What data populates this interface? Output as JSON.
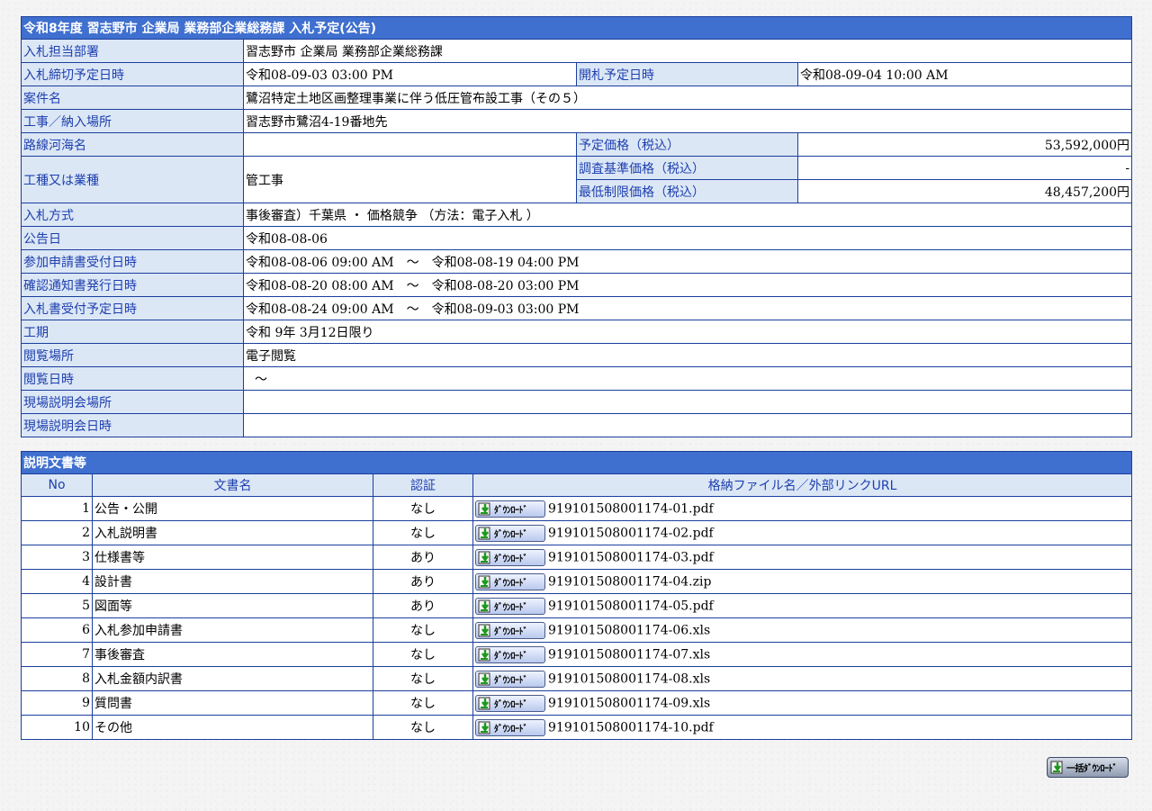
{
  "info": {
    "title": "令和8年度 習志野市 企業局 業務部企業総務課 入札予定(公告)",
    "rows": {
      "dept": {
        "label": "入札担当部署",
        "value": "習志野市 企業局 業務部企業総務課"
      },
      "deadline": {
        "label": "入札締切予定日時",
        "value": "令和08-09-03 03:00 PM"
      },
      "opening": {
        "label": "開札予定日時",
        "value": "令和08-09-04 10:00 AM"
      },
      "project": {
        "label": "案件名",
        "value": "鷺沼特定土地区画整理事業に伴う低圧管布設工事（その５）"
      },
      "location": {
        "label": "工事／納入場所",
        "value": "習志野市鷺沼4-19番地先"
      },
      "route": {
        "label": "路線河海名",
        "value": ""
      },
      "planned_price": {
        "label": "予定価格（税込）",
        "value": "53,592,000円"
      },
      "category": {
        "label": "工種又は業種",
        "value": "管工事"
      },
      "survey_price": {
        "label": "調査基準価格（税込）",
        "value": "-"
      },
      "min_price": {
        "label": "最低制限価格（税込）",
        "value": "48,457,200円"
      },
      "method": {
        "label": "入札方式",
        "value": "事後審査）千葉県 ・ 価格競争 （方法：電子入札 ）"
      },
      "notice_date": {
        "label": "公告日",
        "value": "令和08-08-06"
      },
      "application": {
        "label": "参加申請書受付日時",
        "value": "令和08-08-06 09:00 AM　～　令和08-08-19 04:00 PM"
      },
      "confirmation": {
        "label": "確認通知書発行日時",
        "value": "令和08-08-20 08:00 AM　～　令和08-08-20 03:00 PM"
      },
      "bid_receipt": {
        "label": "入札書受付予定日時",
        "value": "令和08-08-24 09:00 AM　～　令和08-09-03 03:00 PM"
      },
      "period": {
        "label": "工期",
        "value": "令和 9年 3月12日限り"
      },
      "viewing_place": {
        "label": "閲覧場所",
        "value": "電子閲覧"
      },
      "viewing_date": {
        "label": "閲覧日時",
        "value": "～"
      },
      "briefing_place": {
        "label": "現場説明会場所",
        "value": ""
      },
      "briefing_date": {
        "label": "現場説明会日時",
        "value": ""
      }
    }
  },
  "documents": {
    "title": "説明文書等",
    "headers": {
      "no": "No",
      "name": "文書名",
      "auth": "認証",
      "file": "格納ファイル名／外部リンクURL"
    },
    "download_label": "ﾀﾞｳﾝﾛｰﾄﾞ",
    "rows": [
      {
        "no": "1",
        "name": "公告・公開",
        "auth": "なし",
        "file": "919101508001174-01.pdf"
      },
      {
        "no": "2",
        "name": "入札説明書",
        "auth": "なし",
        "file": "919101508001174-02.pdf"
      },
      {
        "no": "3",
        "name": "仕様書等",
        "auth": "あり",
        "file": "919101508001174-03.pdf"
      },
      {
        "no": "4",
        "name": "設計書",
        "auth": "あり",
        "file": "919101508001174-04.zip"
      },
      {
        "no": "5",
        "name": "図面等",
        "auth": "あり",
        "file": "919101508001174-05.pdf"
      },
      {
        "no": "6",
        "name": "入札参加申請書",
        "auth": "なし",
        "file": "919101508001174-06.xls"
      },
      {
        "no": "7",
        "name": "事後審査",
        "auth": "なし",
        "file": "919101508001174-07.xls"
      },
      {
        "no": "8",
        "name": "入札金額内訳書",
        "auth": "なし",
        "file": "919101508001174-08.xls"
      },
      {
        "no": "9",
        "name": "質問書",
        "auth": "なし",
        "file": "919101508001174-09.xls"
      },
      {
        "no": "10",
        "name": "その他",
        "auth": "なし",
        "file": "919101508001174-10.pdf"
      }
    ]
  },
  "bulk_download": {
    "label": "一括ﾀﾞｳﾝﾛｰﾄﾞ"
  }
}
